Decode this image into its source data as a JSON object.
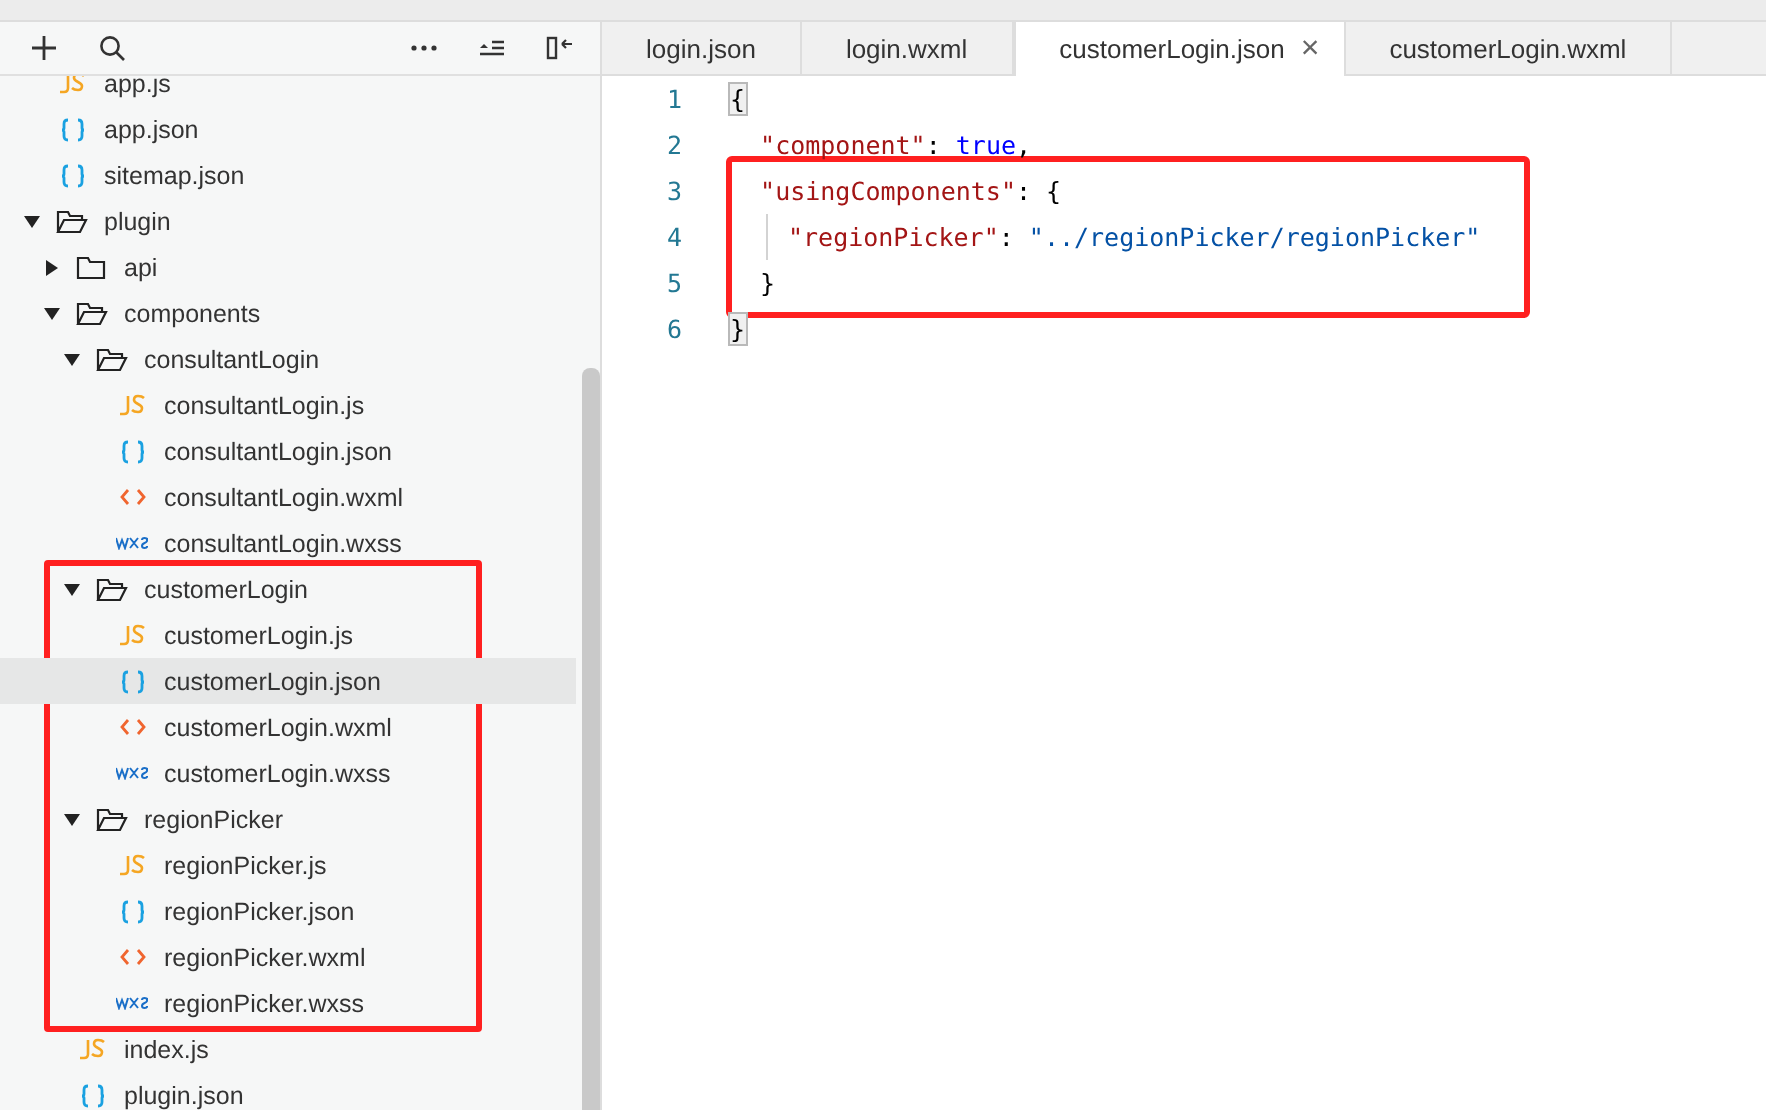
{
  "sidebar": {
    "toolbar": [
      {
        "kind": "add"
      },
      {
        "kind": "search"
      },
      {
        "kind": "more"
      },
      {
        "kind": "collapse"
      },
      {
        "kind": "hide"
      }
    ],
    "tree": [
      {
        "label": "app.js",
        "kind": "js",
        "selected": false
      },
      {
        "label": "app.json",
        "kind": "json",
        "selected": false
      },
      {
        "label": "sitemap.json",
        "kind": "json",
        "selected": false
      },
      {
        "label": "plugin",
        "kind": "folder",
        "expanded": true,
        "selected": false,
        "children": [
          {
            "label": "api",
            "kind": "folder",
            "expanded": false,
            "selected": false
          },
          {
            "label": "components",
            "kind": "folder",
            "expanded": true,
            "selected": false,
            "children": [
              {
                "label": "consultantLogin",
                "kind": "folder",
                "expanded": true,
                "selected": false,
                "children": [
                  {
                    "label": "consultantLogin.js",
                    "kind": "js",
                    "selected": false
                  },
                  {
                    "label": "consultantLogin.json",
                    "kind": "json",
                    "selected": false
                  },
                  {
                    "label": "consultantLogin.wxml",
                    "kind": "wxml",
                    "selected": false
                  },
                  {
                    "label": "consultantLogin.wxss",
                    "kind": "wxss",
                    "selected": false
                  }
                ]
              },
              {
                "label": "customerLogin",
                "kind": "folder",
                "expanded": true,
                "boxed": true,
                "selected": false,
                "children": [
                  {
                    "label": "customerLogin.js",
                    "kind": "js",
                    "selected": false
                  },
                  {
                    "label": "customerLogin.json",
                    "kind": "json",
                    "selected": true
                  },
                  {
                    "label": "customerLogin.wxml",
                    "kind": "wxml",
                    "selected": false
                  },
                  {
                    "label": "customerLogin.wxss",
                    "kind": "wxss",
                    "selected": false
                  }
                ]
              },
              {
                "label": "regionPicker",
                "kind": "folder",
                "expanded": true,
                "boxed": true,
                "selected": false,
                "children": [
                  {
                    "label": "regionPicker.js",
                    "kind": "js",
                    "selected": false
                  },
                  {
                    "label": "regionPicker.json",
                    "kind": "json",
                    "selected": false
                  },
                  {
                    "label": "regionPicker.wxml",
                    "kind": "wxml",
                    "selected": false
                  },
                  {
                    "label": "regionPicker.wxss",
                    "kind": "wxss",
                    "selected": false
                  }
                ]
              }
            ]
          },
          {
            "label": "index.js",
            "kind": "js",
            "selected": false
          },
          {
            "label": "plugin.json",
            "kind": "json",
            "selected": false
          }
        ]
      }
    ]
  },
  "editor": {
    "tabs": [
      {
        "label": "login.json",
        "selected": false
      },
      {
        "label": "login.wxml",
        "selected": false
      },
      {
        "label": "customerLogin.json",
        "selected": true,
        "close": "×"
      },
      {
        "label": "customerLogin.wxml",
        "selected": false
      }
    ],
    "lines": [
      {
        "number": "1",
        "tokens": [
          {
            "kind": "punct",
            "text": "{",
            "matched": true
          }
        ]
      },
      {
        "number": "2",
        "tokens": [
          {
            "kind": "key",
            "text": "  \"component\""
          },
          {
            "kind": "punct",
            "text": ": "
          },
          {
            "kind": "literal",
            "text": "true"
          },
          {
            "kind": "punct",
            "text": ","
          }
        ]
      },
      {
        "number": "3",
        "boxed": true,
        "tokens": [
          {
            "kind": "key",
            "text": "  \"usingComponents\""
          },
          {
            "kind": "punct",
            "text": ": {"
          }
        ]
      },
      {
        "number": "4",
        "boxed": true,
        "guide": true,
        "tokens": [
          {
            "kind": "key",
            "text": "\"regionPicker\""
          },
          {
            "kind": "punct",
            "text": ": "
          },
          {
            "kind": "string",
            "text": "\"../regionPicker/regionPicker\""
          }
        ]
      },
      {
        "number": "5",
        "boxed": true,
        "tokens": [
          {
            "kind": "punct",
            "text": "  }"
          }
        ]
      },
      {
        "number": "6",
        "tokens": [
          {
            "kind": "punct",
            "text": "}",
            "matched": true
          }
        ]
      }
    ]
  }
}
